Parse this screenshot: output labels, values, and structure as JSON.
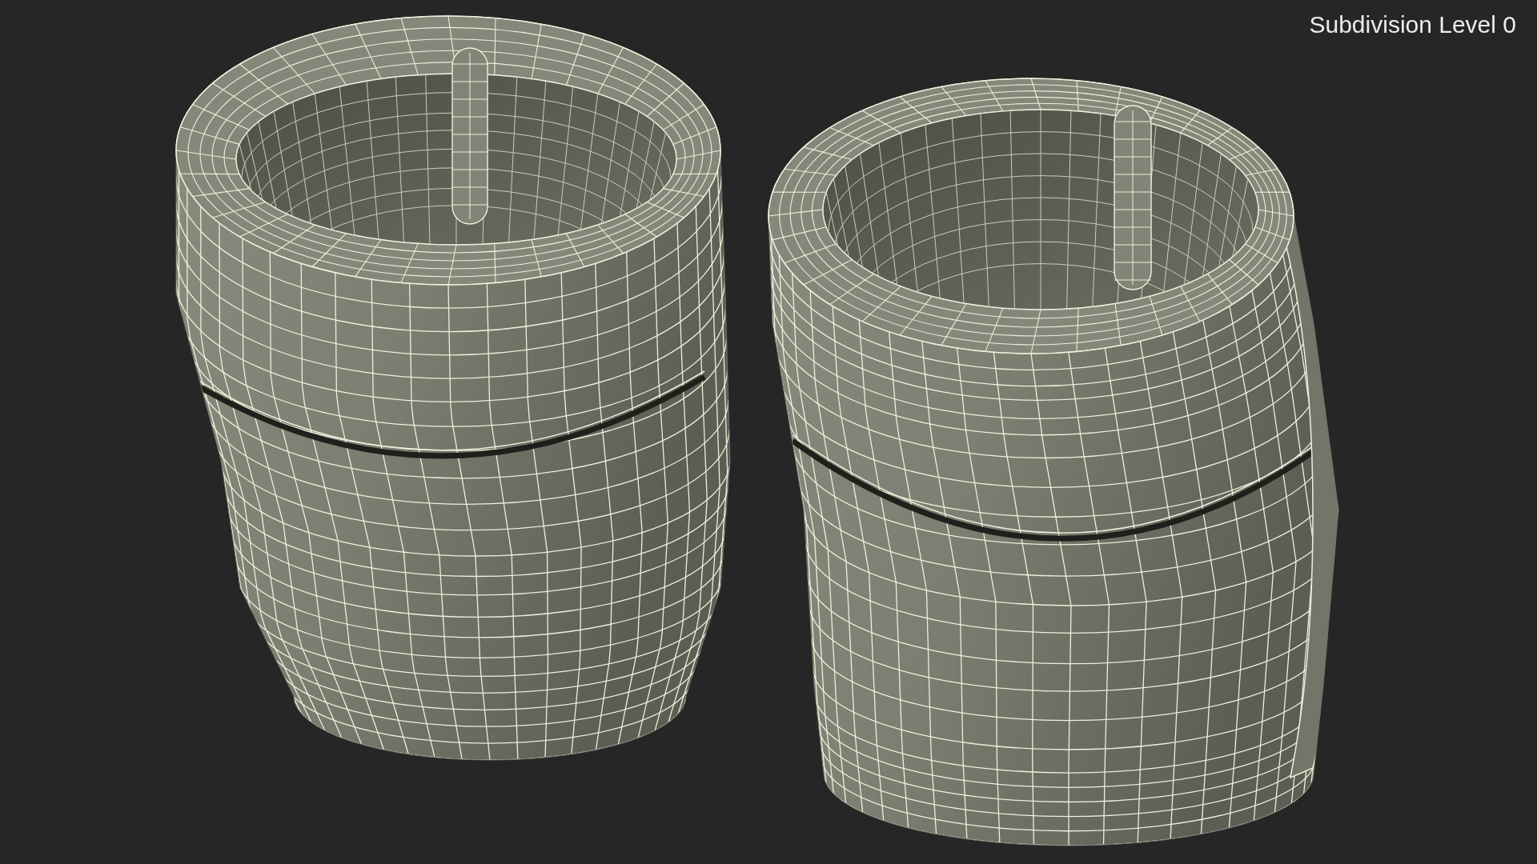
{
  "viewport": {
    "label": "Subdivision Level 0"
  }
}
